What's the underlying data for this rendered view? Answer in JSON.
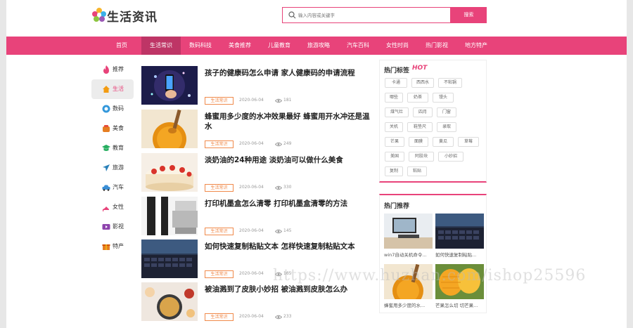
{
  "logo": {
    "text": "生活资讯"
  },
  "search": {
    "placeholder": "输入内容或关键字",
    "button_label": "搜索"
  },
  "nav": {
    "items": [
      {
        "label": "首页"
      },
      {
        "label": "生活常识"
      },
      {
        "label": "数码科技"
      },
      {
        "label": "美食推荐"
      },
      {
        "label": "儿童教育"
      },
      {
        "label": "旅游攻略"
      },
      {
        "label": "汽车百科"
      },
      {
        "label": "女性时尚"
      },
      {
        "label": "热门影视"
      },
      {
        "label": "地方特产"
      }
    ],
    "active_index": 1
  },
  "sidebar": {
    "items": [
      {
        "label": "推荐",
        "icon": "fire-icon"
      },
      {
        "label": "生活",
        "icon": "home-icon"
      },
      {
        "label": "数码",
        "icon": "camera-icon"
      },
      {
        "label": "美食",
        "icon": "food-icon"
      },
      {
        "label": "教育",
        "icon": "graduation-cap-icon"
      },
      {
        "label": "旅游",
        "icon": "airplane-icon"
      },
      {
        "label": "汽车",
        "icon": "car-icon"
      },
      {
        "label": "女性",
        "icon": "high-heel-icon"
      },
      {
        "label": "影视",
        "icon": "video-icon"
      },
      {
        "label": "特产",
        "icon": "gift-icon"
      }
    ],
    "active_index": 1
  },
  "articles": [
    {
      "title": "孩子的健康码怎么申请 家人健康码的申请流程",
      "tag": "生活常识",
      "date": "2020-06-04",
      "views": "181"
    },
    {
      "title": "蜂蜜用多少度的水冲效果最好 蜂蜜用开水冲还是温水",
      "tag": "生活常识",
      "date": "2020-06-04",
      "views": "249"
    },
    {
      "title": "淡奶油的24种用途 淡奶油可以做什么美食",
      "tag": "生活常识",
      "date": "2020-06-04",
      "views": "330"
    },
    {
      "title": "打印机墨盒怎么清零 打印机墨盒清零的方法",
      "tag": "生活常识",
      "date": "2020-06-04",
      "views": "145"
    },
    {
      "title": "如何快速复制粘贴文本 怎样快速复制粘贴文本",
      "tag": "生活常识",
      "date": "2020-06-04",
      "views": "165"
    },
    {
      "title": "被油溅到了皮肤小妙招 被油溅到皮肤怎么办",
      "tag": "生活常识",
      "date": "2020-06-04",
      "views": "233"
    }
  ],
  "hot_tags": {
    "title": "热门标签",
    "hot_label": "HOT",
    "tags": [
      "卡通",
      "西西水",
      "不粘锅",
      "哪些",
      "奶茶",
      "馒头",
      "煤气灶",
      "四月",
      "门窗",
      "关机",
      "鞋垫尺",
      "录取",
      "芒果",
      "面膜",
      "黄瓜",
      "草莓",
      "美国",
      "阿胶块",
      "小妙招",
      "复制",
      "粘贴"
    ]
  },
  "recommend": {
    "title": "热门推荐",
    "items": [
      {
        "caption": "win7自动关机命令..."
      },
      {
        "caption": "如何快速复制粘贴..."
      },
      {
        "caption": "蜂蜜用多少度的水..."
      },
      {
        "caption": "芒果怎么切 切芒果..."
      }
    ]
  },
  "watermark": "https://www.huzhan.com/ishop25596",
  "colors": {
    "accent": "#e8437a",
    "nav_active": "#be3566",
    "tag_border": "#f08a4b"
  }
}
